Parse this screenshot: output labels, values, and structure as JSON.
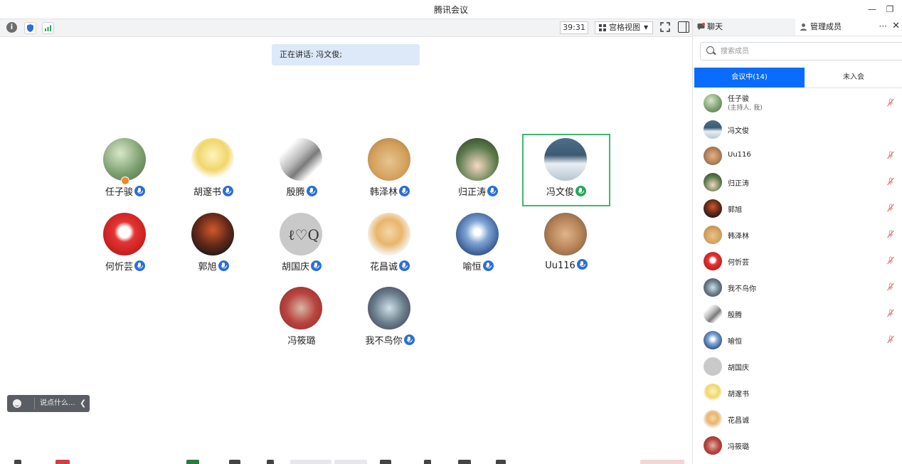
{
  "window": {
    "title": "腾讯会议"
  },
  "toolbar": {
    "timer": "39:31",
    "view_label": "宫格视图"
  },
  "speaking_banner": "正在讲话: 冯文俊;",
  "participants": [
    {
      "name": "任子骏",
      "mic": "on",
      "host": true
    },
    {
      "name": "胡邃书",
      "mic": "on"
    },
    {
      "name": "殷腾",
      "mic": "on"
    },
    {
      "name": "韩泽林",
      "mic": "on"
    },
    {
      "name": "归正涛",
      "mic": "on"
    },
    {
      "name": "冯文俊",
      "mic": "active",
      "speaking": true
    },
    {
      "name": "何忻芸",
      "mic": "on"
    },
    {
      "name": "郭旭",
      "mic": "on"
    },
    {
      "name": "胡国庆",
      "mic": "on"
    },
    {
      "name": "花昌诚",
      "mic": "on"
    },
    {
      "name": "喻恒",
      "mic": "on"
    },
    {
      "name": "Uu116",
      "mic": "on"
    },
    {
      "name": "冯筱璐",
      "mic": "none"
    },
    {
      "name": "我不鸟你",
      "mic": "on"
    }
  ],
  "chat_input": {
    "placeholder": "说点什么..."
  },
  "side_panel": {
    "tab_chat": "聊天",
    "tab_members": "管理成员",
    "more": "···",
    "close": "✕",
    "search_placeholder": "搜索成员",
    "seg_in_meeting": "会议中(14)",
    "seg_not_joined": "未入会",
    "members": [
      {
        "name": "任子骏",
        "role": "(主持人, 我)",
        "muted": true
      },
      {
        "name": "冯文俊",
        "muted": false
      },
      {
        "name": "Uu116",
        "muted": true
      },
      {
        "name": "归正涛",
        "muted": true
      },
      {
        "name": "郭旭",
        "muted": true
      },
      {
        "name": "韩泽林",
        "muted": true
      },
      {
        "name": "何忻芸",
        "muted": true
      },
      {
        "name": "我不鸟你",
        "muted": true
      },
      {
        "name": "殷腾",
        "muted": true
      },
      {
        "name": "喻恒",
        "muted": true
      },
      {
        "name": "胡国庆",
        "muted": false
      },
      {
        "name": "胡邃书",
        "muted": false
      },
      {
        "name": "花昌诚",
        "muted": false
      },
      {
        "name": "冯筱璐",
        "muted": false
      }
    ]
  },
  "colors": {
    "accent_blue": "#0a6cff",
    "mic_blue": "#2b6fd6",
    "speaking_green": "#28a65c",
    "banner_bg": "#dde9f8"
  }
}
